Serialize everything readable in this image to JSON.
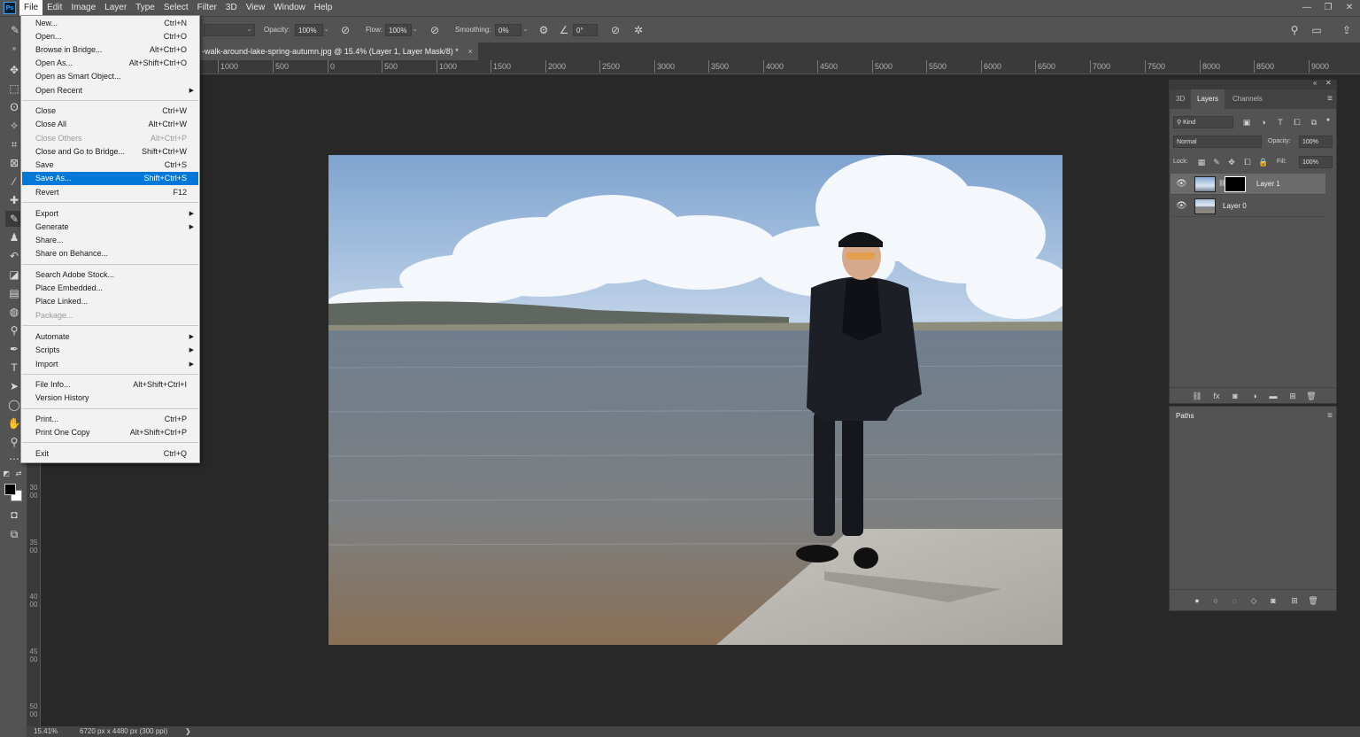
{
  "app": {
    "logo_text": "Ps",
    "accent_color": "#31a8ff",
    "menu": [
      "File",
      "Edit",
      "Image",
      "Layer",
      "Type",
      "Select",
      "Filter",
      "3D",
      "View",
      "Window",
      "Help"
    ],
    "window_controls": [
      "—",
      "❐",
      "✕"
    ]
  },
  "options_bar": {
    "opacity_label": "Opacity:",
    "opacity_value": "100%",
    "flow_label": "Flow:",
    "flow_value": "100%",
    "smoothing_label": "Smoothing:",
    "smoothing_value": "0%",
    "angle_value": "0°"
  },
  "document": {
    "tab_title": "-walk-around-lake-spring-autumn.jpg @ 15.4% (Layer 1, Layer Mask/8) *",
    "tab_close": "×"
  },
  "ruler": {
    "top_labels": [
      "1000",
      "500",
      "0",
      "500",
      "1000",
      "1500",
      "2000",
      "2500",
      "3000",
      "3500",
      "4000",
      "4500",
      "5000",
      "5500",
      "6000",
      "6500",
      "7000",
      "7500",
      "8000",
      "8500",
      "9000"
    ],
    "left_labels": [
      "3000",
      "3500",
      "4000",
      "4500",
      "5000"
    ]
  },
  "status": {
    "zoom": "15.41%",
    "doc_info": "6720 px x 4480 px (300 ppi)",
    "arrow": "❯"
  },
  "file_menu": {
    "items": [
      {
        "label": "New...",
        "shortcut": "Ctrl+N"
      },
      {
        "label": "Open...",
        "shortcut": "Ctrl+O"
      },
      {
        "label": "Browse in Bridge...",
        "shortcut": "Alt+Ctrl+O"
      },
      {
        "label": "Open As...",
        "shortcut": "Alt+Shift+Ctrl+O"
      },
      {
        "label": "Open as Smart Object...",
        "shortcut": ""
      },
      {
        "label": "Open Recent",
        "shortcut": "",
        "submenu": true
      },
      {
        "label": "Close",
        "shortcut": "Ctrl+W"
      },
      {
        "label": "Close All",
        "shortcut": "Alt+Ctrl+W"
      },
      {
        "label": "Close Others",
        "shortcut": "Alt+Ctrl+P",
        "disabled": true
      },
      {
        "label": "Close and Go to Bridge...",
        "shortcut": "Shift+Ctrl+W"
      },
      {
        "label": "Save",
        "shortcut": "Ctrl+S"
      },
      {
        "label": "Save As...",
        "shortcut": "Shift+Ctrl+S",
        "highlighted": true
      },
      {
        "label": "Revert",
        "shortcut": "F12"
      },
      {
        "label": "Export",
        "shortcut": "",
        "submenu": true
      },
      {
        "label": "Generate",
        "shortcut": "",
        "submenu": true
      },
      {
        "label": "Share...",
        "shortcut": ""
      },
      {
        "label": "Share on Behance...",
        "shortcut": ""
      },
      {
        "label": "Search Adobe Stock...",
        "shortcut": ""
      },
      {
        "label": "Place Embedded...",
        "shortcut": ""
      },
      {
        "label": "Place Linked...",
        "shortcut": ""
      },
      {
        "label": "Package...",
        "shortcut": "",
        "disabled": true
      },
      {
        "label": "Automate",
        "shortcut": "",
        "submenu": true
      },
      {
        "label": "Scripts",
        "shortcut": "",
        "submenu": true
      },
      {
        "label": "Import",
        "shortcut": "",
        "submenu": true
      },
      {
        "label": "File Info...",
        "shortcut": "Alt+Shift+Ctrl+I"
      },
      {
        "label": "Version History",
        "shortcut": ""
      },
      {
        "label": "Print...",
        "shortcut": "Ctrl+P"
      },
      {
        "label": "Print One Copy",
        "shortcut": "Alt+Shift+Ctrl+P"
      },
      {
        "label": "Exit",
        "shortcut": "Ctrl+Q"
      }
    ],
    "highlight_color": "#0078d7"
  },
  "layers_panel": {
    "tabs": [
      "3D",
      "Layers",
      "Channels"
    ],
    "filter_label": "Kind",
    "blend_mode": "Normal",
    "opacity_label": "Opacity:",
    "opacity_value": "100%",
    "lock_label": "Lock:",
    "fill_label": "Fill:",
    "fill_value": "100%",
    "layers": [
      {
        "name": "Layer 1",
        "selected": true
      },
      {
        "name": "Layer 0",
        "selected": false
      }
    ]
  },
  "paths_panel": {
    "title": "Paths"
  }
}
